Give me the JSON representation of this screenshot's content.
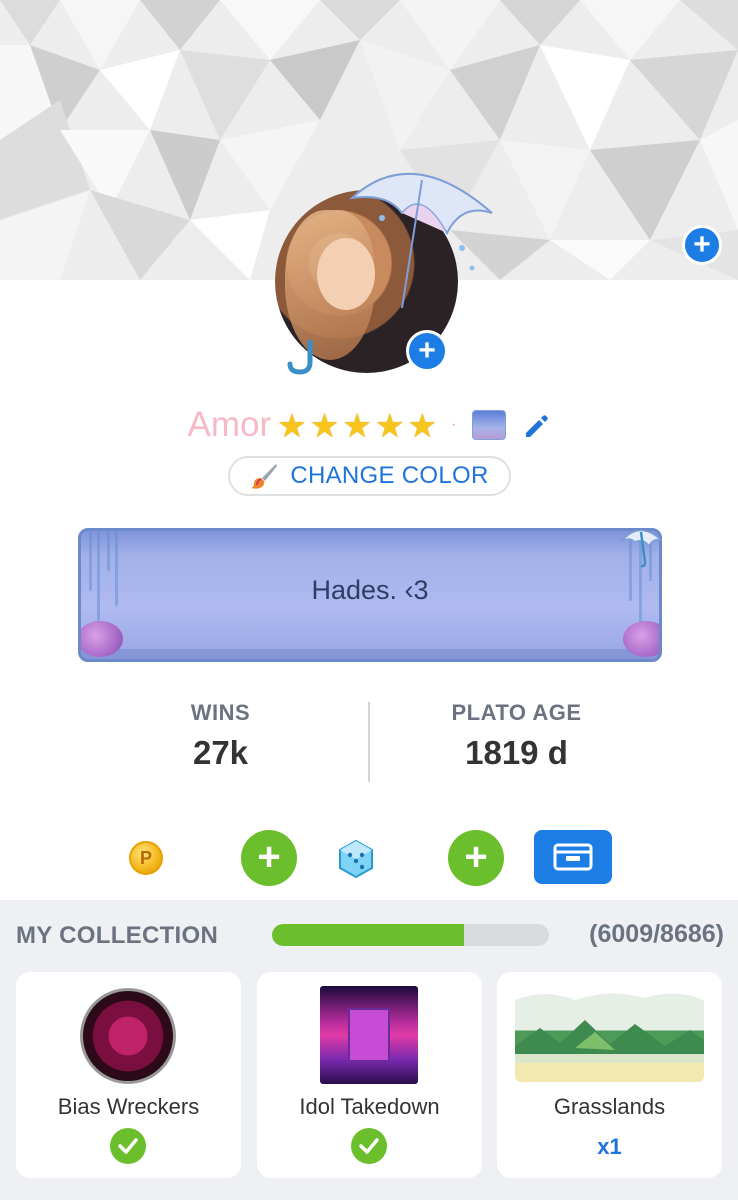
{
  "profile": {
    "name": "Amor",
    "stars": 5,
    "name_color": "#f7b8c8",
    "change_color_label": "CHANGE COLOR",
    "bio": "Hades. ‹3"
  },
  "stats": {
    "wins_label": "WINS",
    "wins_value": "27k",
    "age_label": "PLATO AGE",
    "age_value": "1819 d"
  },
  "currency": {
    "coin_symbol": "P"
  },
  "collection": {
    "title": "MY COLLECTION",
    "progress_text": "(6009/8686)",
    "progress_fraction": 0.6918,
    "items": [
      {
        "name": "Bias Wreckers",
        "status": "owned",
        "icon": "check-icon"
      },
      {
        "name": "Idol Takedown",
        "status": "owned",
        "icon": "check-icon"
      },
      {
        "name": "Grasslands",
        "status": "quantity",
        "quantity": "x1"
      }
    ]
  },
  "colors": {
    "accent_blue": "#1c7de4",
    "accent_green": "#6cbf2c",
    "star_yellow": "#f7c51e"
  }
}
